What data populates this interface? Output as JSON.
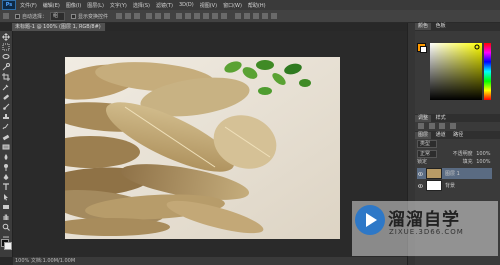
{
  "menubar": {
    "app_icon": "Ps",
    "items": [
      "文件(F)",
      "编辑(E)",
      "图像(I)",
      "图层(L)",
      "文字(Y)",
      "选择(S)",
      "滤镜(T)",
      "3D(D)",
      "视图(V)",
      "窗口(W)",
      "帮助(H)"
    ]
  },
  "options": {
    "auto_select_label": "自动选择：",
    "auto_select_value": "组",
    "transform_label": "显示变换控件"
  },
  "document": {
    "tab_title": "未标题-1 @ 100% (图层 1, RGB/8#)",
    "status_text": "100%  文档:1.00M/1.00M"
  },
  "panels": {
    "color_tabs": [
      "颜色",
      "色板"
    ],
    "colors": {
      "foreground": "#ff9a00",
      "background": "#ffffff"
    },
    "adjust_tabs": [
      "调整",
      "样式"
    ],
    "layers_tabs": [
      "图层",
      "通道",
      "路径"
    ],
    "kind_label": "类型",
    "blend_mode": "正常",
    "opacity_label": "不透明度",
    "opacity_value": "100%",
    "lock_label": "锁定",
    "fill_label": "填充",
    "fill_value": "100%",
    "layers": [
      {
        "name": "图层 1",
        "selected": true
      },
      {
        "name": "背景",
        "selected": false
      }
    ]
  },
  "watermark": {
    "title": "溜溜自学",
    "url": "ZIXUE.3D66.COM"
  }
}
